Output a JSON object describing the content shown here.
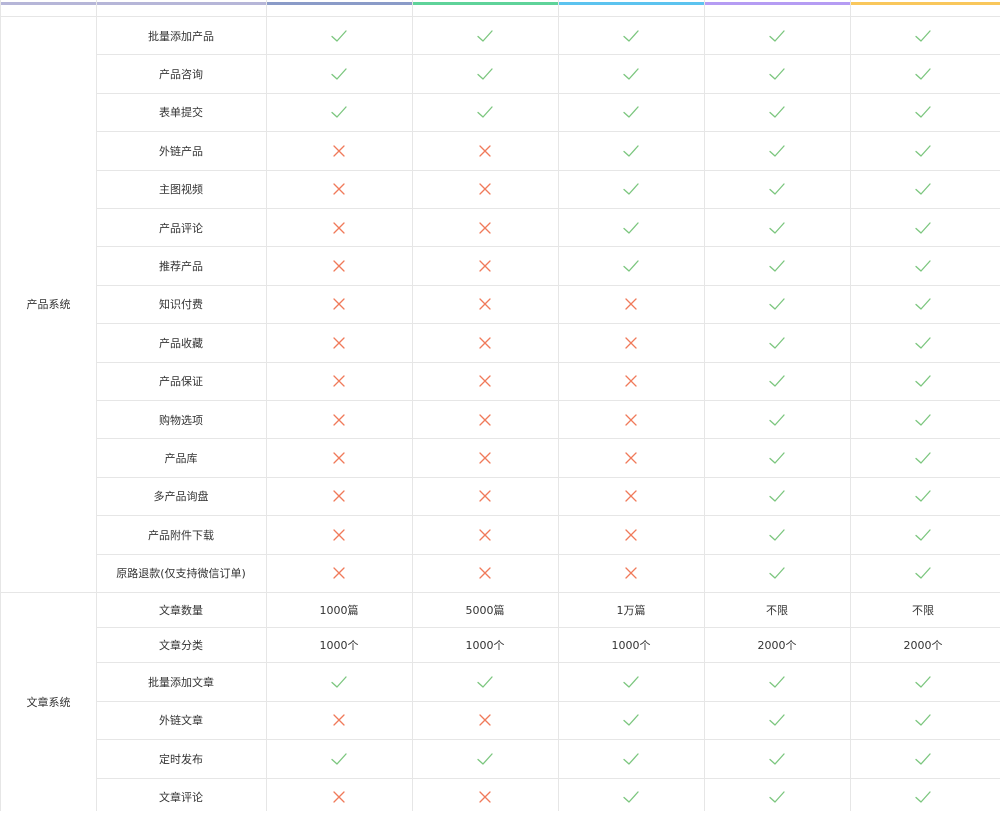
{
  "colors": {
    "check": "#7bc67e",
    "cross": "#f07a5a",
    "border": "#e6e6e6",
    "stripes": [
      "#b6b6d8",
      "#8a9bc8",
      "#5fd39a",
      "#5cc3ef",
      "#b59cf3",
      "#f9c75c"
    ]
  },
  "groups": [
    {
      "label": "产品系统",
      "rows": [
        {
          "feature": "批量添加产品",
          "values": [
            "check",
            "check",
            "check",
            "check",
            "check"
          ]
        },
        {
          "feature": "产品咨询",
          "values": [
            "check",
            "check",
            "check",
            "check",
            "check"
          ]
        },
        {
          "feature": "表单提交",
          "values": [
            "check",
            "check",
            "check",
            "check",
            "check"
          ]
        },
        {
          "feature": "外链产品",
          "values": [
            "cross",
            "cross",
            "check",
            "check",
            "check"
          ]
        },
        {
          "feature": "主图视频",
          "values": [
            "cross",
            "cross",
            "check",
            "check",
            "check"
          ]
        },
        {
          "feature": "产品评论",
          "values": [
            "cross",
            "cross",
            "check",
            "check",
            "check"
          ]
        },
        {
          "feature": "推荐产品",
          "values": [
            "cross",
            "cross",
            "check",
            "check",
            "check"
          ]
        },
        {
          "feature": "知识付费",
          "values": [
            "cross",
            "cross",
            "cross",
            "check",
            "check"
          ]
        },
        {
          "feature": "产品收藏",
          "values": [
            "cross",
            "cross",
            "cross",
            "check",
            "check"
          ]
        },
        {
          "feature": "产品保证",
          "values": [
            "cross",
            "cross",
            "cross",
            "check",
            "check"
          ]
        },
        {
          "feature": "购物选项",
          "values": [
            "cross",
            "cross",
            "cross",
            "check",
            "check"
          ]
        },
        {
          "feature": "产品库",
          "values": [
            "cross",
            "cross",
            "cross",
            "check",
            "check"
          ]
        },
        {
          "feature": "多产品询盘",
          "values": [
            "cross",
            "cross",
            "cross",
            "check",
            "check"
          ]
        },
        {
          "feature": "产品附件下载",
          "values": [
            "cross",
            "cross",
            "cross",
            "check",
            "check"
          ]
        },
        {
          "feature": "原路退款(仅支持微信订单)",
          "values": [
            "cross",
            "cross",
            "cross",
            "check",
            "check"
          ]
        }
      ]
    },
    {
      "label": "文章系统",
      "rows": [
        {
          "feature": "文章数量",
          "values": [
            "1000篇",
            "5000篇",
            "1万篇",
            "不限",
            "不限"
          ]
        },
        {
          "feature": "文章分类",
          "values": [
            "1000个",
            "1000个",
            "1000个",
            "2000个",
            "2000个"
          ]
        },
        {
          "feature": "批量添加文章",
          "values": [
            "check",
            "check",
            "check",
            "check",
            "check"
          ]
        },
        {
          "feature": "外链文章",
          "values": [
            "cross",
            "cross",
            "check",
            "check",
            "check"
          ]
        },
        {
          "feature": "定时发布",
          "values": [
            "check",
            "check",
            "check",
            "check",
            "check"
          ]
        },
        {
          "feature": "文章评论",
          "values": [
            "cross",
            "cross",
            "check",
            "check",
            "check"
          ]
        }
      ]
    }
  ]
}
